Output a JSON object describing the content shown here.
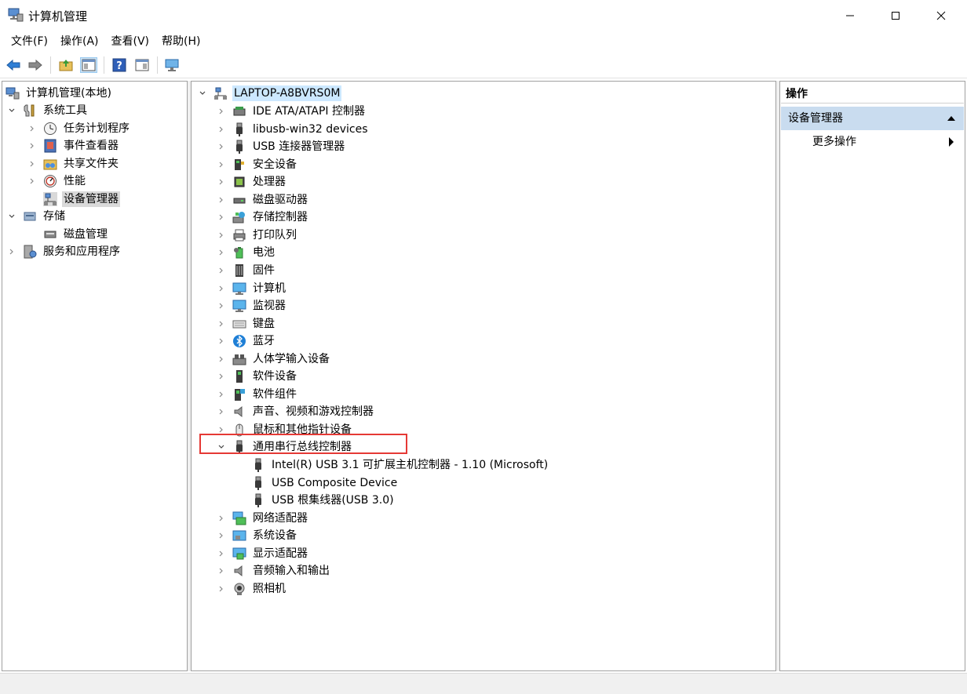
{
  "window": {
    "title": "计算机管理",
    "controls": {
      "minimize": "—",
      "maximize": "☐",
      "close": "✕"
    }
  },
  "menu": [
    {
      "label": "文件(F)"
    },
    {
      "label": "操作(A)"
    },
    {
      "label": "查看(V)"
    },
    {
      "label": "帮助(H)"
    }
  ],
  "toolbar": {
    "buttons": [
      "back-icon",
      "forward-icon",
      "up-folder-icon",
      "show-hide-tree-icon",
      "help-icon",
      "properties-icon",
      "computer-view-icon"
    ]
  },
  "left_tree": [
    {
      "label": "计算机管理(本地)",
      "icon": "computer-management-icon",
      "level": 0,
      "twisty": "none"
    },
    {
      "label": "系统工具",
      "icon": "tools-icon",
      "level": 1,
      "twisty": "open"
    },
    {
      "label": "任务计划程序",
      "icon": "clock-icon",
      "level": 2,
      "twisty": "closed"
    },
    {
      "label": "事件查看器",
      "icon": "event-viewer-icon",
      "level": 2,
      "twisty": "closed"
    },
    {
      "label": "共享文件夹",
      "icon": "shared-folder-icon",
      "level": 2,
      "twisty": "closed"
    },
    {
      "label": "性能",
      "icon": "performance-icon",
      "level": 2,
      "twisty": "closed"
    },
    {
      "label": "设备管理器",
      "icon": "device-manager-icon",
      "level": 2,
      "twisty": "none",
      "selected": true
    },
    {
      "label": "存储",
      "icon": "storage-icon",
      "level": 1,
      "twisty": "open"
    },
    {
      "label": "磁盘管理",
      "icon": "disk-management-icon",
      "level": 2,
      "twisty": "none"
    },
    {
      "label": "服务和应用程序",
      "icon": "services-icon",
      "level": 1,
      "twisty": "closed"
    }
  ],
  "device_tree": {
    "root": "LAPTOP-A8BVRS0M",
    "categories": [
      {
        "label": "IDE ATA/ATAPI 控制器",
        "icon": "ide-controller-icon"
      },
      {
        "label": "libusb-win32 devices",
        "icon": "usb-plug-icon"
      },
      {
        "label": "USB 连接器管理器",
        "icon": "usb-plug-icon"
      },
      {
        "label": "安全设备",
        "icon": "security-device-icon"
      },
      {
        "label": "处理器",
        "icon": "processor-icon"
      },
      {
        "label": "磁盘驱动器",
        "icon": "disk-drive-icon"
      },
      {
        "label": "存储控制器",
        "icon": "storage-controller-icon"
      },
      {
        "label": "打印队列",
        "icon": "printer-icon"
      },
      {
        "label": "电池",
        "icon": "battery-icon"
      },
      {
        "label": "固件",
        "icon": "firmware-icon"
      },
      {
        "label": "计算机",
        "icon": "monitor-icon"
      },
      {
        "label": "监视器",
        "icon": "monitor-icon"
      },
      {
        "label": "键盘",
        "icon": "keyboard-icon"
      },
      {
        "label": "蓝牙",
        "icon": "bluetooth-icon"
      },
      {
        "label": "人体学输入设备",
        "icon": "hid-icon"
      },
      {
        "label": "软件设备",
        "icon": "software-device-icon"
      },
      {
        "label": "软件组件",
        "icon": "software-component-icon"
      },
      {
        "label": "声音、视频和游戏控制器",
        "icon": "speaker-icon"
      },
      {
        "label": "鼠标和其他指针设备",
        "icon": "mouse-icon"
      },
      {
        "label": "通用串行总线控制器",
        "icon": "usb-plug-icon",
        "expanded": true,
        "children": [
          {
            "label": "Intel(R) USB 3.1 可扩展主机控制器 - 1.10 (Microsoft)",
            "icon": "usb-plug-icon"
          },
          {
            "label": "USB Composite Device",
            "icon": "usb-plug-icon"
          },
          {
            "label": "USB 根集线器(USB 3.0)",
            "icon": "usb-plug-icon"
          }
        ]
      },
      {
        "label": "网络适配器",
        "icon": "network-adapter-icon"
      },
      {
        "label": "系统设备",
        "icon": "system-device-icon"
      },
      {
        "label": "显示适配器",
        "icon": "display-adapter-icon"
      },
      {
        "label": "音频输入和输出",
        "icon": "speaker-icon"
      },
      {
        "label": "照相机",
        "icon": "camera-icon"
      }
    ]
  },
  "actions_pane": {
    "header": "操作",
    "section": "设备管理器",
    "item": "更多操作"
  },
  "colors": {
    "highlight_box": "#e53935",
    "root_selection": "#cce8ff",
    "action_section": "#c9dcef"
  }
}
